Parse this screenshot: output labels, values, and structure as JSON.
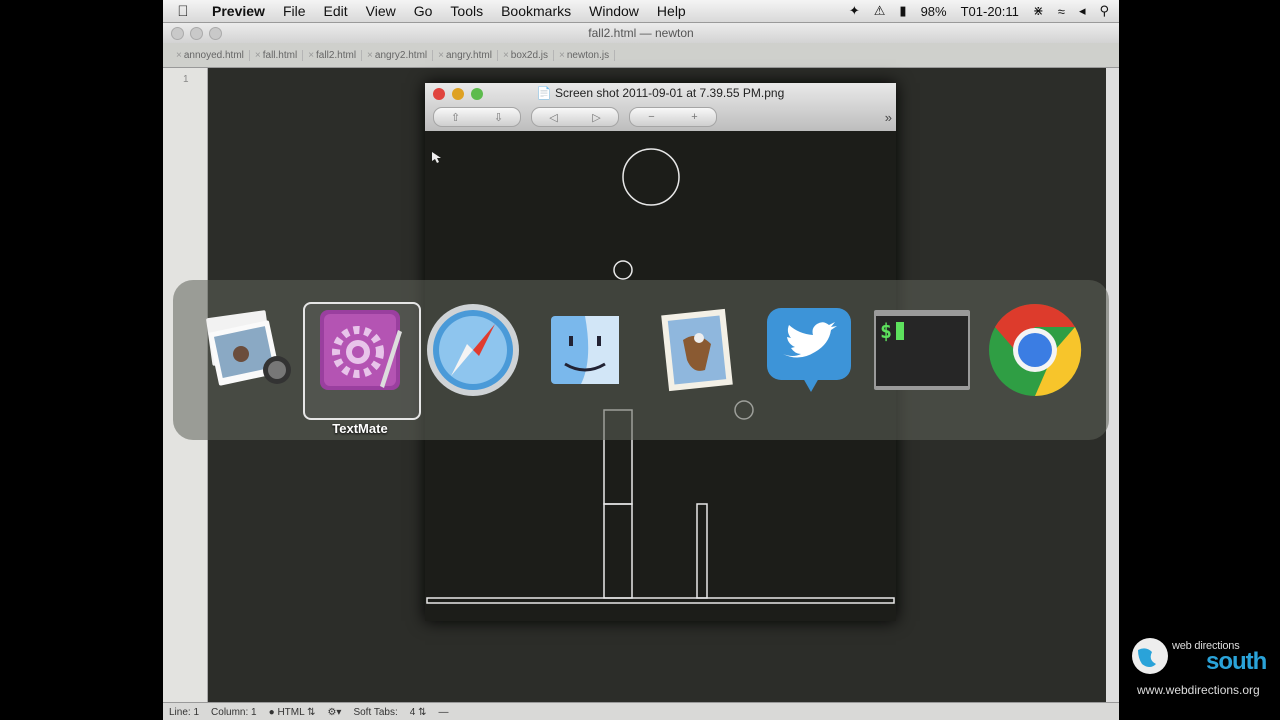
{
  "menubar": {
    "app": "Preview",
    "items": [
      "File",
      "Edit",
      "View",
      "Go",
      "Tools",
      "Bookmarks",
      "Window",
      "Help"
    ],
    "battery": "98%",
    "clock": "T01-20:11"
  },
  "editor": {
    "title": "fall2.html — newton",
    "tabs": [
      "annoyed.html",
      "fall.html",
      "fall2.html",
      "angry2.html",
      "angry.html",
      "box2d.js",
      "newton.js"
    ],
    "line_number": "1",
    "status": {
      "line": "Line: 1",
      "column": "Column: 1",
      "language": "HTML",
      "soft_tabs_label": "Soft Tabs:",
      "soft_tabs_value": "4"
    }
  },
  "preview": {
    "title": "Screen shot 2011-09-01 at 7.39.55 PM.png"
  },
  "switcher": {
    "apps": [
      "iPhoto",
      "TextMate",
      "Safari",
      "Finder",
      "Mail",
      "Twitter",
      "Terminal",
      "Chrome"
    ],
    "selected_label": "TextMate"
  },
  "logo": {
    "line1": "web directions",
    "line2": "south",
    "url": "www.webdirections.org"
  },
  "colors": {
    "twitter": "#3d94d8",
    "logo_blue": "#2aa3d9",
    "textmate": "#9a3f9f"
  }
}
